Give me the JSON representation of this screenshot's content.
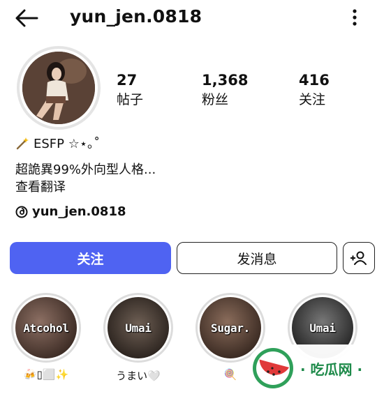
{
  "header": {
    "username": "yun_jen.0818"
  },
  "stats": {
    "posts": {
      "value": "27",
      "label": "帖子"
    },
    "followers": {
      "value": "1,368",
      "label": "粉丝"
    },
    "following": {
      "value": "416",
      "label": "关注"
    }
  },
  "bio": {
    "line1": "ESFP ☆⋆｡˚",
    "line2": "超詭異99%外向型人格...",
    "translate": "查看翻译",
    "threads_handle": "yun_jen.0818"
  },
  "actions": {
    "follow": "关注",
    "message": "发消息"
  },
  "highlights": [
    {
      "title": "Atcohol",
      "label": "🍻▯⬜✨"
    },
    {
      "title": "Umai",
      "label": "うまい🤍"
    },
    {
      "title": "Sugar.",
      "label": "🍭"
    },
    {
      "title": "Umai",
      "label": ""
    }
  ],
  "watermark": {
    "text": "· 吃瓜网 ·"
  },
  "colors": {
    "accent": "#4f63f2",
    "watermark_green": "#1e8a4a"
  }
}
